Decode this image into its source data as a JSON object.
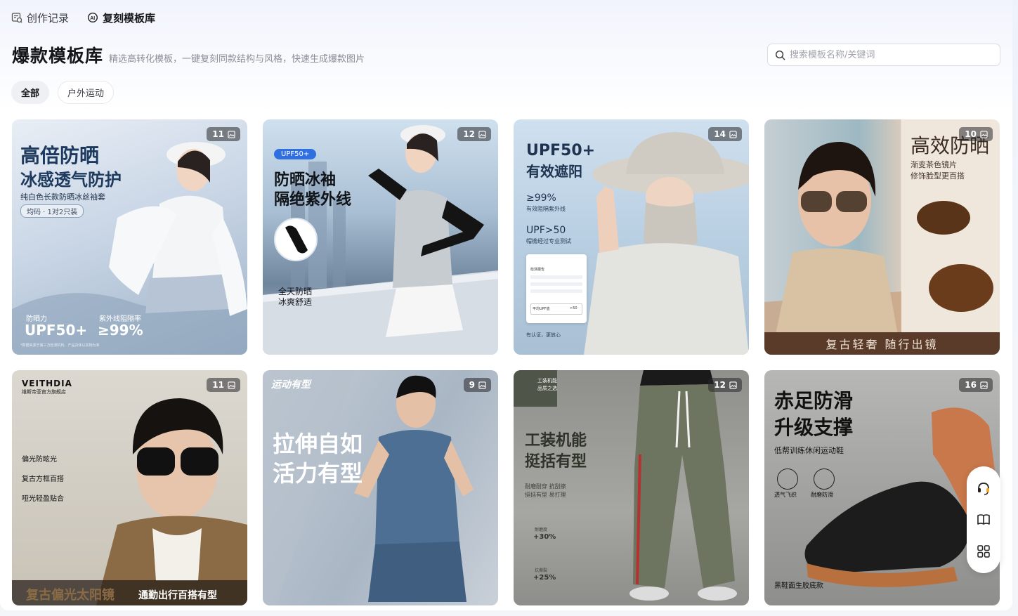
{
  "nav": {
    "tabs": [
      {
        "label": "创作记录",
        "icon": "history-icon"
      },
      {
        "label": "复刻模板库",
        "icon": "ai-sparkle-icon"
      }
    ],
    "active": 1
  },
  "header": {
    "title": "爆款模板库",
    "subtitle": "精选高转化模板，一键复刻同款结构与风格，快速生成爆款图片"
  },
  "search": {
    "placeholder": "搜索模板名称/关键词",
    "value": ""
  },
  "filters": [
    {
      "label": "全部",
      "active": true
    },
    {
      "label": "户外运动",
      "active": false
    }
  ],
  "cards": [
    {
      "count": "11",
      "lines": [
        "高倍防晒",
        "冰感透气防护",
        "纯白色长款防晒冰丝袖套",
        "均码 · 1对2只装",
        "防晒力",
        "UPF50+",
        "紫外线阻隔率",
        "≥99%",
        "*数据来源于第三方检测机构，产品具体以实物为准"
      ]
    },
    {
      "count": "12",
      "lines": [
        "UPF50+",
        "防晒冰袖",
        "隔绝紫外线",
        "全天防晒",
        "冰爽舒适"
      ]
    },
    {
      "count": "14",
      "lines": [
        "UPF50+",
        "有效遮阳",
        "≥99%",
        "有效阻隔紫外线",
        "UPF>50",
        "帽檐经过专业测试",
        "检测报告",
        "平均UPF值",
        ">50",
        "有认证，更放心"
      ]
    },
    {
      "count": "10",
      "lines": [
        "高效防晒",
        "渐变茶色镜片",
        "修饰脸型更百搭",
        "复古轻奢 随行出镜"
      ]
    },
    {
      "count": "11",
      "lines": [
        "VEITHDIA",
        "维斯帝亚官方旗舰店",
        "偏光防眩光",
        "复古方框百搭",
        "哑光轻盈贴合",
        "复古偏光太阳镜",
        "通勤出行百搭有型"
      ]
    },
    {
      "count": "9",
      "lines": [
        "运动有型",
        "拉伸自如",
        "活力有型"
      ]
    },
    {
      "count": "12",
      "lines": [
        "工装机能",
        "品质之选",
        "工装机能",
        "挺括有型",
        "耐磨耐穿 抗刮擦",
        "挺括有型 易打理",
        "耐磨度",
        "+30%",
        "抗撕裂",
        "+25%"
      ]
    },
    {
      "count": "16",
      "lines": [
        "赤足防滑",
        "升级支撑",
        "低帮训练休闲运动鞋",
        "透气飞织",
        "耐磨防滑",
        "黑鞋面生胶底款"
      ]
    }
  ],
  "float_toolbar": [
    "headset-icon",
    "book-icon",
    "grid-apps-icon"
  ],
  "colors": {
    "accent": "#2f6fe0",
    "title": "#15161a",
    "subtitle": "#8a8d96"
  }
}
